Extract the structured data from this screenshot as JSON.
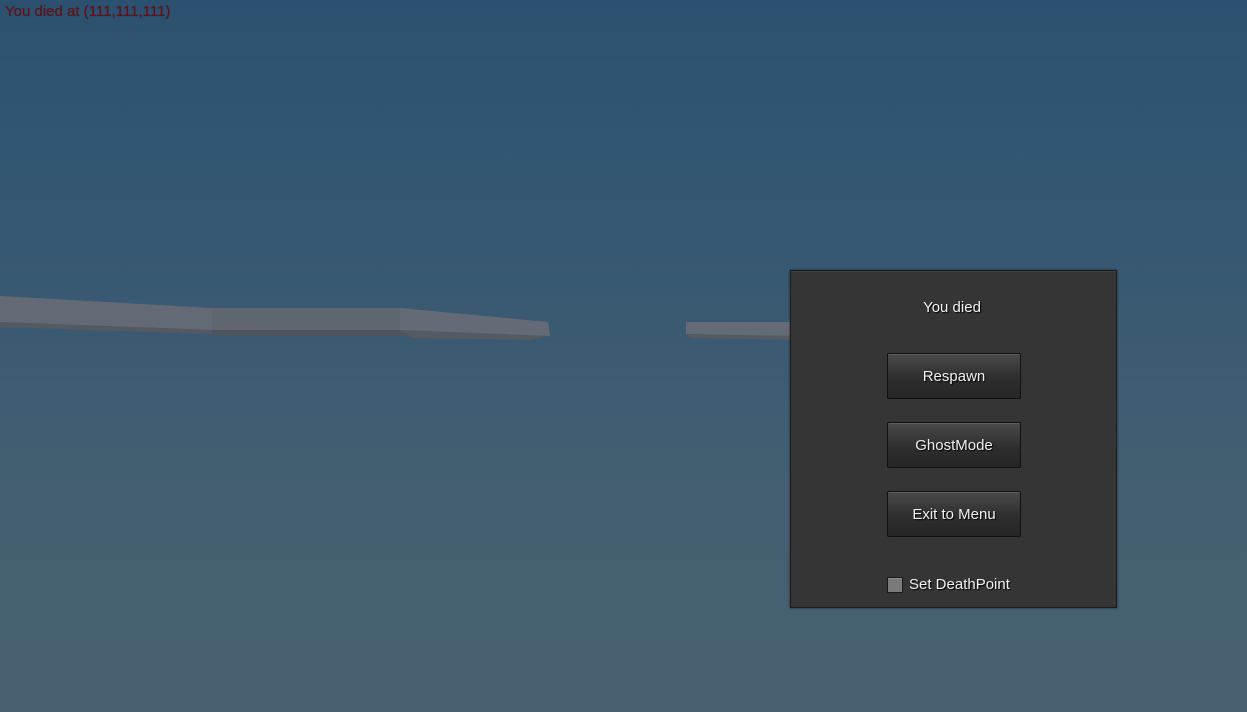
{
  "hud": {
    "death_message": "You died at (111,111,111)",
    "death_message_color": "#6b0d12"
  },
  "dialog": {
    "title": "You died",
    "respawn_label": "Respawn",
    "ghost_mode_label": "GhostMode",
    "exit_label": "Exit to Menu",
    "set_deathpoint_label": "Set DeathPoint",
    "set_deathpoint_checked": false
  },
  "colors": {
    "sky_top": "#2c5170",
    "sky_bottom": "#46606f",
    "panel": "#353535",
    "platform": "#5e6470"
  }
}
